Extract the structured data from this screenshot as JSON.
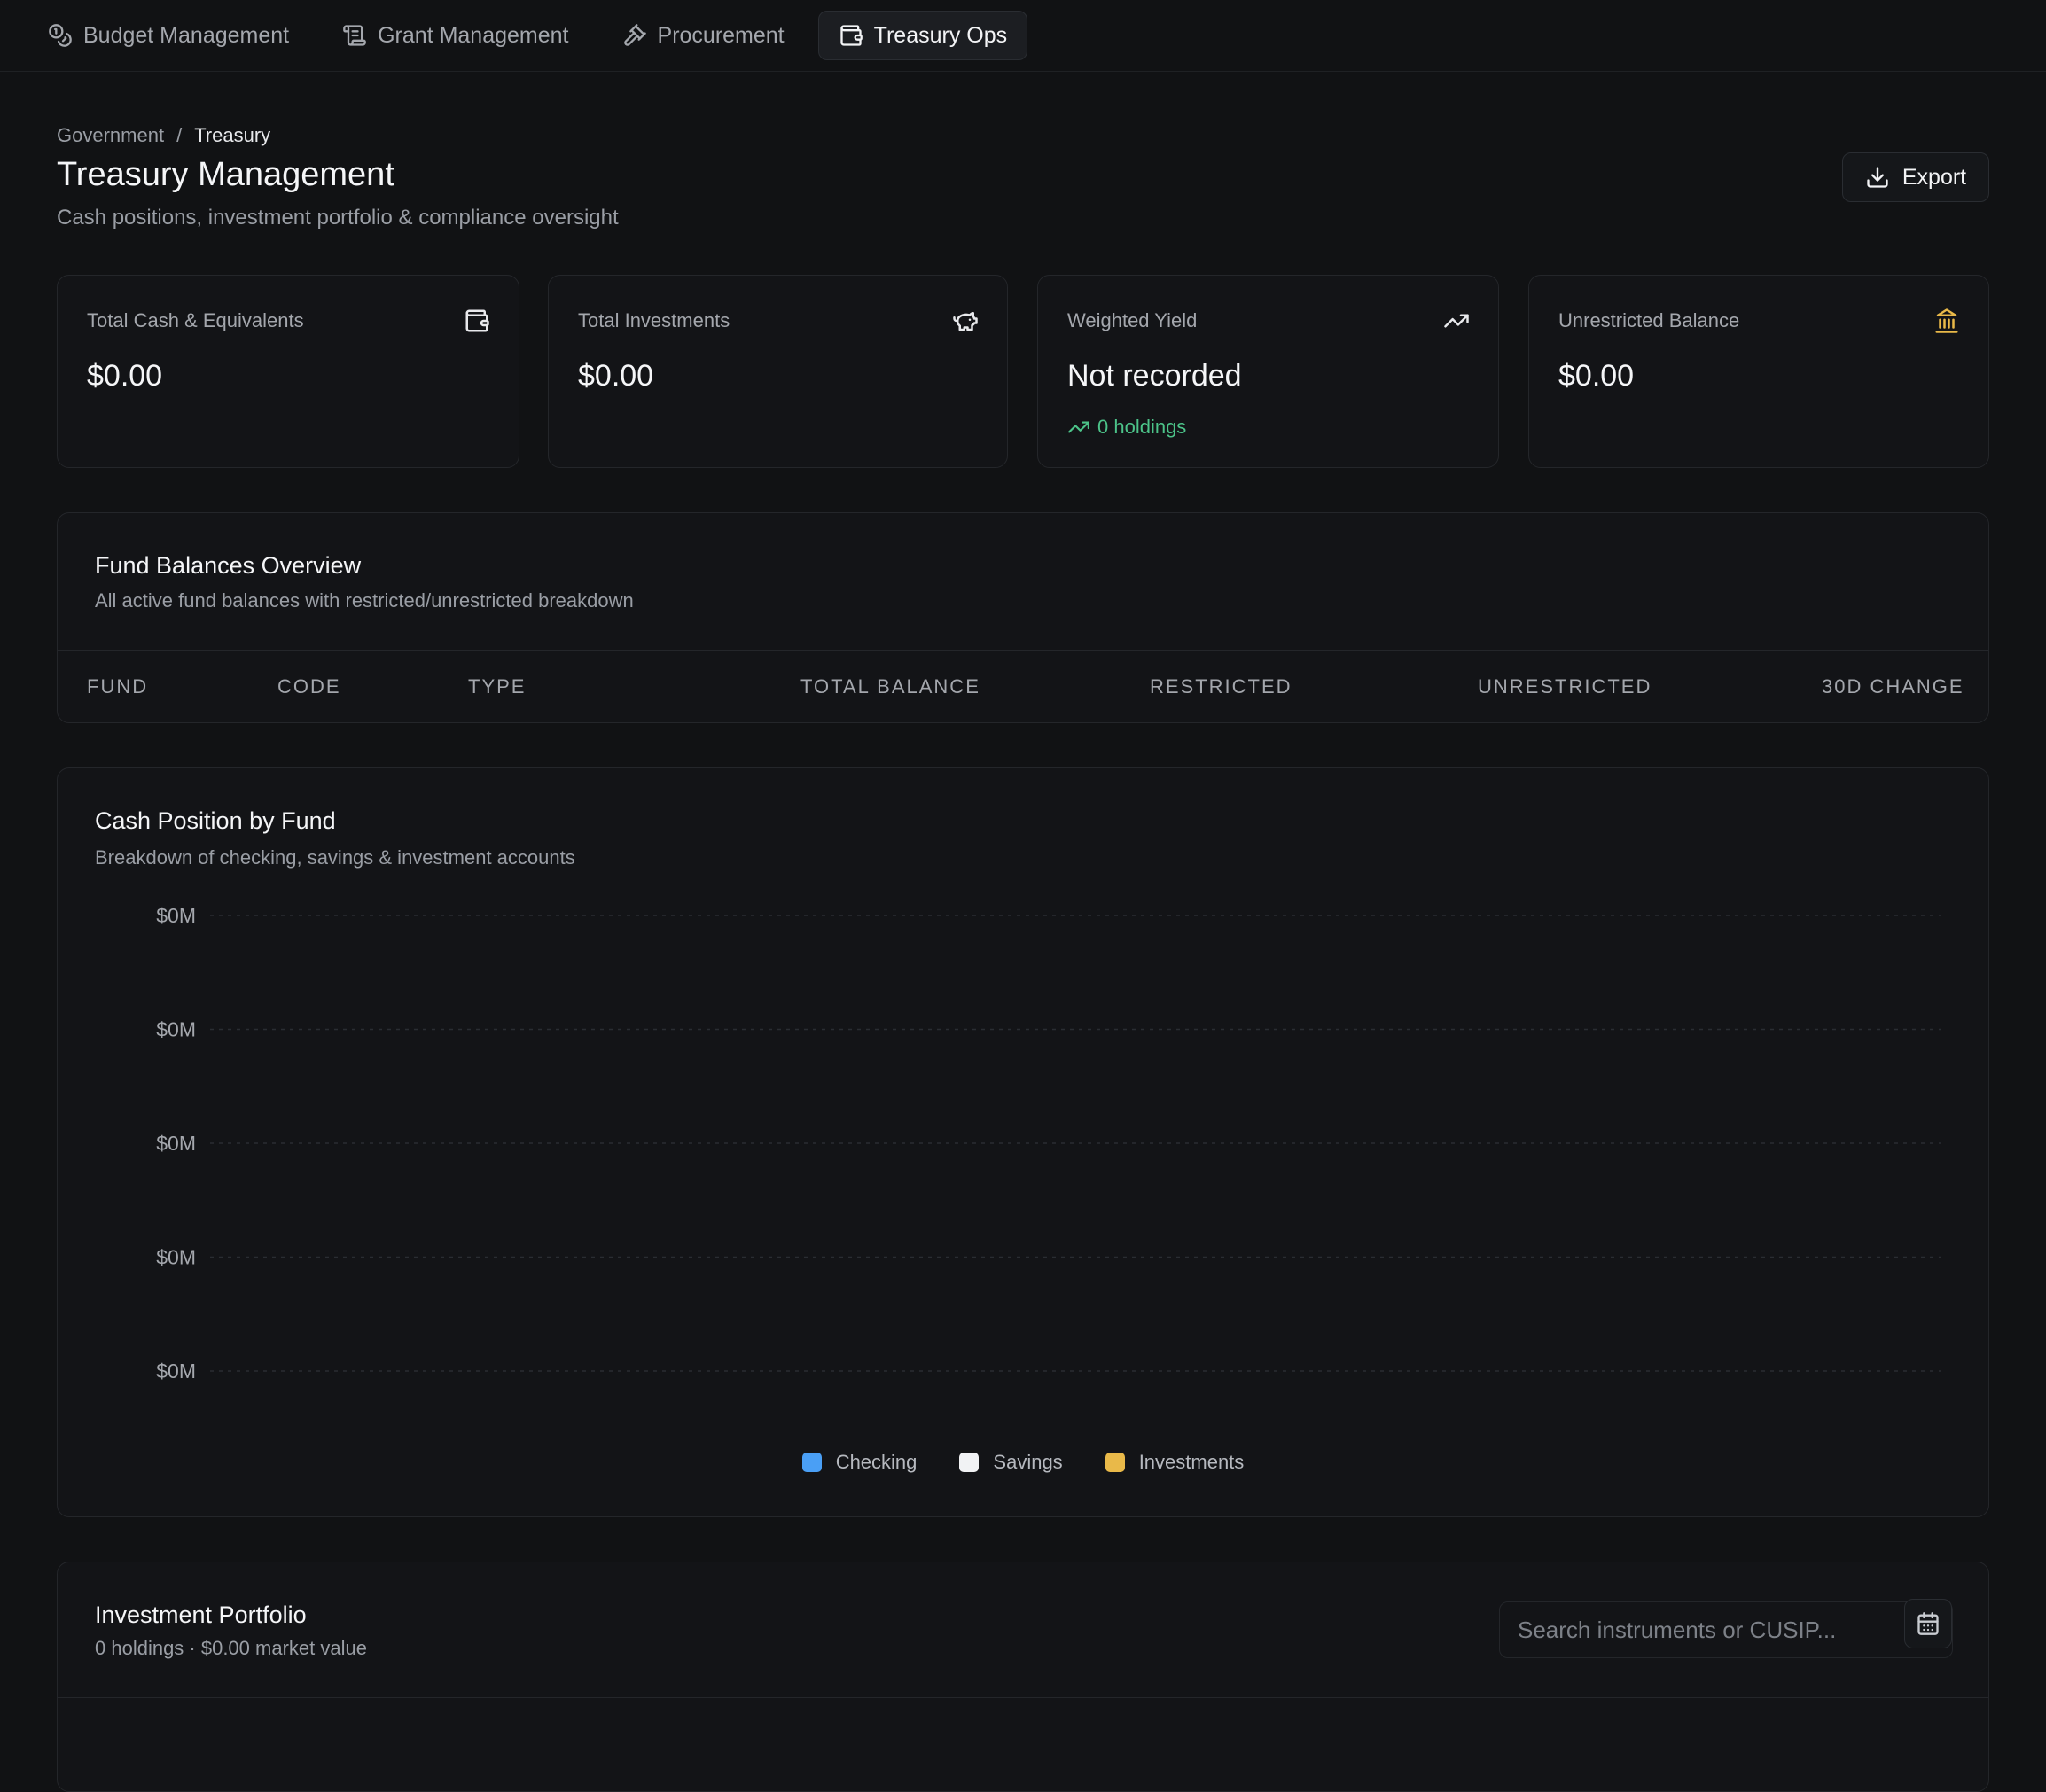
{
  "nav": {
    "tabs": [
      {
        "label": "Budget Management",
        "icon": "coins-icon",
        "active": false
      },
      {
        "label": "Grant Management",
        "icon": "scroll-icon",
        "active": false
      },
      {
        "label": "Procurement",
        "icon": "gavel-icon",
        "active": false
      },
      {
        "label": "Treasury Ops",
        "icon": "wallet-icon",
        "active": true
      }
    ]
  },
  "breadcrumb": {
    "root": "Government",
    "separator": "/",
    "current": "Treasury"
  },
  "header": {
    "title": "Treasury Management",
    "subtitle": "Cash positions, investment portfolio & compliance oversight",
    "export_label": "Export"
  },
  "stats": [
    {
      "label": "Total Cash & Equivalents",
      "value": "$0.00",
      "icon": "wallet-icon",
      "icon_color": "#e8e9ec"
    },
    {
      "label": "Total Investments",
      "value": "$0.00",
      "icon": "piggy-bank-icon",
      "icon_color": "#e8e9ec"
    },
    {
      "label": "Weighted Yield",
      "value": "Not recorded",
      "icon": "trending-up-icon",
      "icon_color": "#e8e9ec",
      "sub": "0 holdings",
      "sub_color": "#4cc389"
    },
    {
      "label": "Unrestricted Balance",
      "value": "$0.00",
      "icon": "landmark-icon",
      "icon_color": "#e9b949"
    }
  ],
  "fund_balances": {
    "title": "Fund Balances Overview",
    "description": "All active fund balances with restricted/unrestricted breakdown",
    "columns": [
      "FUND",
      "CODE",
      "TYPE",
      "TOTAL BALANCE",
      "RESTRICTED",
      "UNRESTRICTED",
      "30D CHANGE"
    ],
    "rows": []
  },
  "cash_position": {
    "title": "Cash Position by Fund",
    "description": "Breakdown of checking, savings & investment accounts"
  },
  "chart_data": {
    "type": "bar",
    "title": "Cash Position by Fund",
    "categories": [],
    "series": [
      {
        "name": "Checking",
        "values": [],
        "color": "#4a9ff5"
      },
      {
        "name": "Savings",
        "values": [],
        "color": "#f1f2f4"
      },
      {
        "name": "Investments",
        "values": [],
        "color": "#e9b949"
      }
    ],
    "y_tick_labels": [
      "$0M",
      "$0M",
      "$0M",
      "$0M",
      "$0M"
    ],
    "grid": true,
    "legend": "bottom-center"
  },
  "portfolio": {
    "title": "Investment Portfolio",
    "summary": "0 holdings · $0.00 market value",
    "search_placeholder": "Search instruments or CUSIP..."
  }
}
